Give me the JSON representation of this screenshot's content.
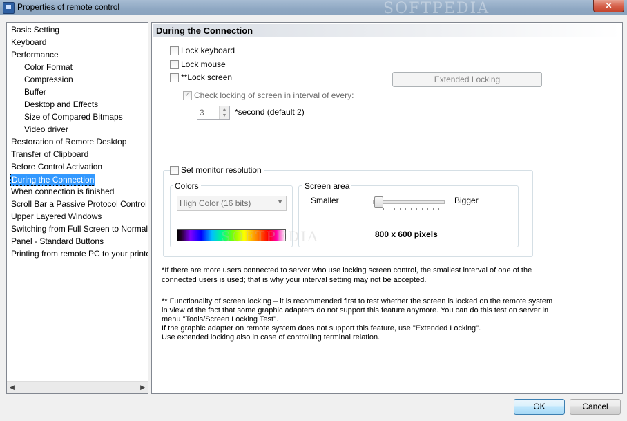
{
  "window": {
    "title": "Properties of remote control",
    "close_label": "✕"
  },
  "tree": {
    "items": [
      {
        "label": "Basic Setting"
      },
      {
        "label": "Keyboard"
      },
      {
        "label": "Performance"
      },
      {
        "label": "Color Format"
      },
      {
        "label": "Compression"
      },
      {
        "label": "Buffer"
      },
      {
        "label": "Desktop and Effects"
      },
      {
        "label": "Size of Compared Bitmaps"
      },
      {
        "label": "Video driver"
      },
      {
        "label": "Restoration of Remote Desktop"
      },
      {
        "label": "Transfer of Clipboard"
      },
      {
        "label": "Before Control Activation"
      },
      {
        "label": "During the Connection"
      },
      {
        "label": "When connection is finished"
      },
      {
        "label": "Scroll Bar a Passive Protocol Control"
      },
      {
        "label": "Upper Layered Windows"
      },
      {
        "label": "Switching from Full Screen to Normal"
      },
      {
        "label": "Panel - Standard Buttons"
      },
      {
        "label": "Printing from remote PC to your printer"
      }
    ],
    "selected": "During the Connection"
  },
  "panel": {
    "title": "During the Connection",
    "lock_keyboard": "Lock keyboard",
    "lock_mouse": "Lock mouse",
    "lock_screen": "**Lock screen",
    "extended_locking": "Extended Locking",
    "check_locking": "Check locking of screen in interval of every:",
    "interval_value": "3",
    "interval_suffix": "*second (default 2)",
    "set_monitor_resolution": "Set monitor resolution",
    "colors_label": "Colors",
    "colors_value": "High Color (16 bits)",
    "screen_area_label": "Screen area",
    "smaller": "Smaller",
    "bigger": "Bigger",
    "resolution": "800 x 600 pixels",
    "slider_level": 0.0
  },
  "notes": {
    "n1_line1": "*If there are more users connected to server who use locking screen control, the smallest interval of one of the",
    "n1_line2": "connected users is used; that is why your interval setting may not be accepted.",
    "n2_line1": "** Functionality of screen locking – it is recommended first to test whether the screen is locked on the remote system",
    "n2_line2": "in view of the fact that some graphic adapters do not support this feature anymore. You can do this test on server in",
    "n2_line3": "menu \"Tools/Screen Locking Test\".",
    "n2_line4": "If the graphic adapter on remote system does not support this feature, use \"Extended Locking\".",
    "n2_line5": "Use extended locking also in case of controlling terminal relation."
  },
  "footer": {
    "ok": "OK",
    "cancel": "Cancel"
  },
  "watermark": {
    "text": "SOFTPEDIA",
    "text2": "SOFTPEDIA"
  }
}
